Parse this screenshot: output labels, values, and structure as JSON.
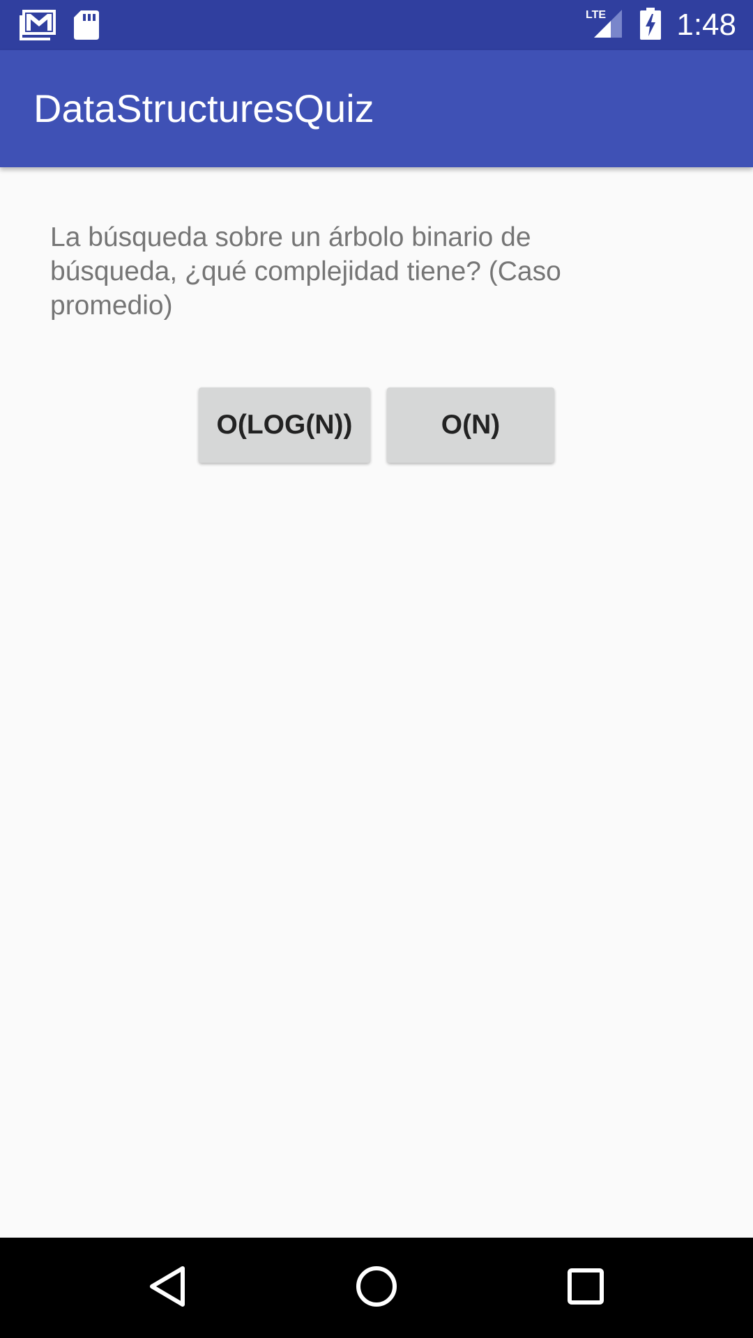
{
  "status_bar": {
    "time": "1:48",
    "network": "LTE",
    "icons": [
      "gmail-icon",
      "sd-card-icon",
      "lte-signal-icon",
      "battery-charging-icon"
    ]
  },
  "app_bar": {
    "title": "DataStructuresQuiz"
  },
  "question": {
    "text": "La búsqueda sobre un árbolo binario de búsqueda, ¿qué complejidad tiene? (Caso promedio)"
  },
  "answers": [
    {
      "label": "O(LOG(N))"
    },
    {
      "label": "O(N)"
    }
  ],
  "nav_bar": {
    "icons": [
      "back-icon",
      "home-icon",
      "recents-icon"
    ]
  },
  "colors": {
    "status_bar": "#303F9F",
    "app_bar": "#3F51B5",
    "background": "#FAFAFA",
    "button": "#D6D7D7",
    "question_text": "#757575"
  }
}
